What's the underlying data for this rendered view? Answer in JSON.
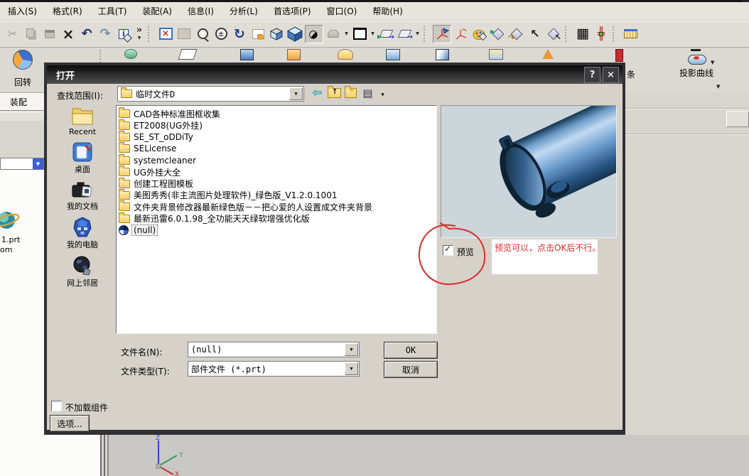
{
  "colors": {
    "annotation_red": "#dd2b2b",
    "model_blue": "#4a7fc0",
    "dialog_title_bar": "#0b0b0b",
    "dialog_bg": "#d6d2ca",
    "preview_bg": "#ccd5da"
  },
  "menu_bar": {
    "items": [
      "插入(S)",
      "格式(R)",
      "工具(T)",
      "装配(A)",
      "信息(I)",
      "分析(L)",
      "首选项(P)",
      "窗口(O)",
      "帮助(H)"
    ]
  },
  "toolbars": {
    "row1_icons": [
      "cut",
      "copy",
      "paste",
      "delete",
      "undo",
      "redo",
      "export-info",
      "overflow",
      "fit-view",
      "fill-view",
      "zoom-box",
      "zoom-in-out",
      "rotate-view",
      "pan-view",
      "shaded-cube",
      "navigation-cube",
      "display-shaded",
      "hidden-edges",
      "blank-view",
      "datum-plane",
      "datum-plane-dropdown",
      "csys-dynamic",
      "csys-orient",
      "role-palette",
      "snap-play",
      "reorder",
      "cursor-select",
      "snap-cursor",
      "grid",
      "point-set",
      "ruler"
    ],
    "row2": {
      "revolve_label": "回转",
      "project_curve_label": "投影曲线",
      "partial_label": "条"
    }
  },
  "left_panel": {
    "assembly_label": "装配",
    "desktop_shortcut_line1": "1.prt",
    "desktop_shortcut_line2": "om"
  },
  "viewport": {
    "axis_x": "X",
    "axis_y": "Y",
    "axis_z": "Z"
  },
  "dialog": {
    "title": "打开",
    "help": "?",
    "close": "×",
    "look_in": {
      "label": "查找范围(I):",
      "value": "临时文件D"
    },
    "nav_icons": [
      "back-icon",
      "up-folder-icon",
      "new-folder-icon",
      "views-icon"
    ],
    "files": [
      {
        "name": "CAD各种标准图框收集",
        "icon": "folder",
        "selected": false
      },
      {
        "name": "ET2008(UG外挂)",
        "icon": "folder",
        "selected": false
      },
      {
        "name": "SE_ST_oDDiTy",
        "icon": "folder",
        "selected": false
      },
      {
        "name": "SELicense",
        "icon": "folder",
        "selected": false
      },
      {
        "name": "systemcleaner",
        "icon": "folder",
        "selected": false
      },
      {
        "name": "UG外挂大全",
        "icon": "folder",
        "selected": false
      },
      {
        "name": "创建工程图模板",
        "icon": "folder",
        "selected": false
      },
      {
        "name": "美图秀秀(非主流图片处理软件)_绿色版_V1.2.0.1001",
        "icon": "folder",
        "selected": false
      },
      {
        "name": "文件夹背景修改器最新绿色版－－把心爱的人设置成文件夹背景",
        "icon": "folder",
        "selected": false
      },
      {
        "name": "最新迅雷6.0.1.98_全功能天天绿软增强优化版",
        "icon": "folder",
        "selected": false
      },
      {
        "name": "(null)",
        "icon": "part",
        "selected": true
      }
    ],
    "places": [
      {
        "label": "Recent",
        "icon": "recent-folder-icon"
      },
      {
        "label": "桌面",
        "icon": "desktop-icon"
      },
      {
        "label": "我的文档",
        "icon": "my-documents-icon"
      },
      {
        "label": "我的电脑",
        "icon": "my-computer-icon"
      },
      {
        "label": "网上邻居",
        "icon": "network-places-icon"
      }
    ],
    "preview": {
      "checkbox_label": "预览",
      "checked": true
    },
    "annotation": {
      "text": "预览可以，点击OK后不行。",
      "color": "#dd2b2b"
    },
    "file_name": {
      "label": "文件名(N):",
      "value": "(null)"
    },
    "file_type": {
      "label": "文件类型(T):",
      "value": "部件文件 (*.prt)"
    },
    "buttons": {
      "ok": "OK",
      "cancel": "取消",
      "options": "选项..."
    },
    "no_load": {
      "label": "不加载组件",
      "checked": false
    }
  }
}
